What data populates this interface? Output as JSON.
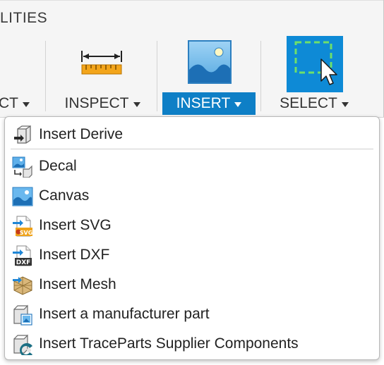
{
  "toolbar": {
    "tab_label": "LITIES",
    "groups": [
      {
        "label": "CT",
        "icon": "construct-icon",
        "active": false
      },
      {
        "label": "INSPECT",
        "icon": "measure-ruler-icon",
        "active": false
      },
      {
        "label": "INSERT",
        "icon": "insert-image-icon",
        "active": true
      },
      {
        "label": "SELECT",
        "icon": "select-window-icon",
        "active": false
      }
    ],
    "accent_color": "#0e7fc6"
  },
  "menu": {
    "items": [
      {
        "label": "Insert Derive",
        "icon": "insert-derive-icon"
      },
      {
        "label": "Decal",
        "icon": "decal-icon"
      },
      {
        "label": "Canvas",
        "icon": "canvas-icon"
      },
      {
        "label": "Insert SVG",
        "icon": "insert-svg-icon"
      },
      {
        "label": "Insert DXF",
        "icon": "insert-dxf-icon"
      },
      {
        "label": "Insert Mesh",
        "icon": "insert-mesh-icon"
      },
      {
        "label": "Insert a manufacturer part",
        "icon": "manufacturer-part-icon"
      },
      {
        "label": "Insert TraceParts Supplier Components",
        "icon": "traceparts-icon"
      }
    ]
  }
}
